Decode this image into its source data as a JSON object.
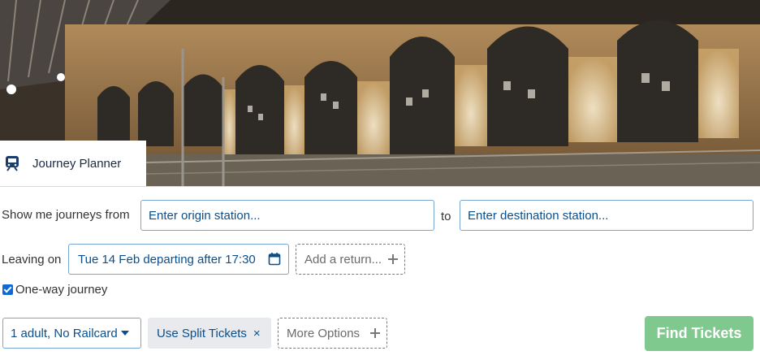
{
  "header": {
    "tab_label": "Journey Planner",
    "tab_icon": "train-icon"
  },
  "journey": {
    "show_me_label": "Show me journeys from",
    "origin_placeholder": "Enter origin station...",
    "to_label": "to",
    "destination_placeholder": "Enter destination station...",
    "leaving_label": "Leaving on",
    "departure_value": "Tue 14 Feb departing after 17:30",
    "calendar_icon": "calendar-icon",
    "add_return_label": "Add a return...",
    "one_way_label": "One-way journey",
    "one_way_checked": true
  },
  "options": {
    "railcard_label": "1 adult, No Railcard",
    "split_tickets_label": "Use Split Tickets",
    "split_remove_glyph": "×",
    "more_options_label": "More Options",
    "find_tickets_label": "Find Tickets"
  },
  "colors": {
    "accent_blue": "#0a4f8c",
    "field_border": "#7aa6d6",
    "find_button_bg": "#80c98e",
    "checkbox_blue": "#0b6bd3"
  }
}
